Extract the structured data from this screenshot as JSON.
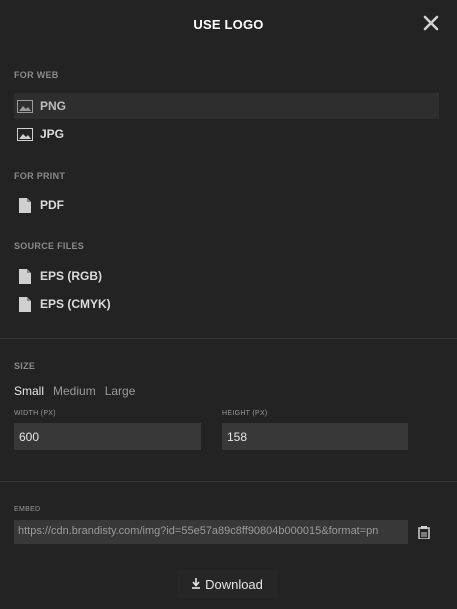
{
  "header": {
    "title": "USE LOGO"
  },
  "sections": {
    "web": {
      "label": "FOR WEB",
      "items": [
        {
          "label": "PNG",
          "icon": "image-icon",
          "selected": true
        },
        {
          "label": "JPG",
          "icon": "image-icon",
          "selected": false
        }
      ]
    },
    "print": {
      "label": "FOR PRINT",
      "items": [
        {
          "label": "PDF",
          "icon": "file-icon"
        }
      ]
    },
    "source": {
      "label": "SOURCE FILES",
      "items": [
        {
          "label": "EPS (RGB)",
          "icon": "file-icon"
        },
        {
          "label": "EPS (CMYK)",
          "icon": "file-icon"
        }
      ]
    }
  },
  "size": {
    "label": "SIZE",
    "options": [
      "Small",
      "Medium",
      "Large"
    ],
    "selected": "Small",
    "width_label": "WIDTH (PX)",
    "width_value": "600",
    "height_label": "HEIGHT (PX)",
    "height_value": "158"
  },
  "embed": {
    "label": "EMBED",
    "url": "https://cdn.brandisty.com/img?id=55e57a89c8ff90804b000015&format=pn"
  },
  "footer": {
    "download_label": "Download"
  },
  "colors": {
    "background": "#232323",
    "field": "#383838",
    "selected_row": "#2e2e2e"
  }
}
